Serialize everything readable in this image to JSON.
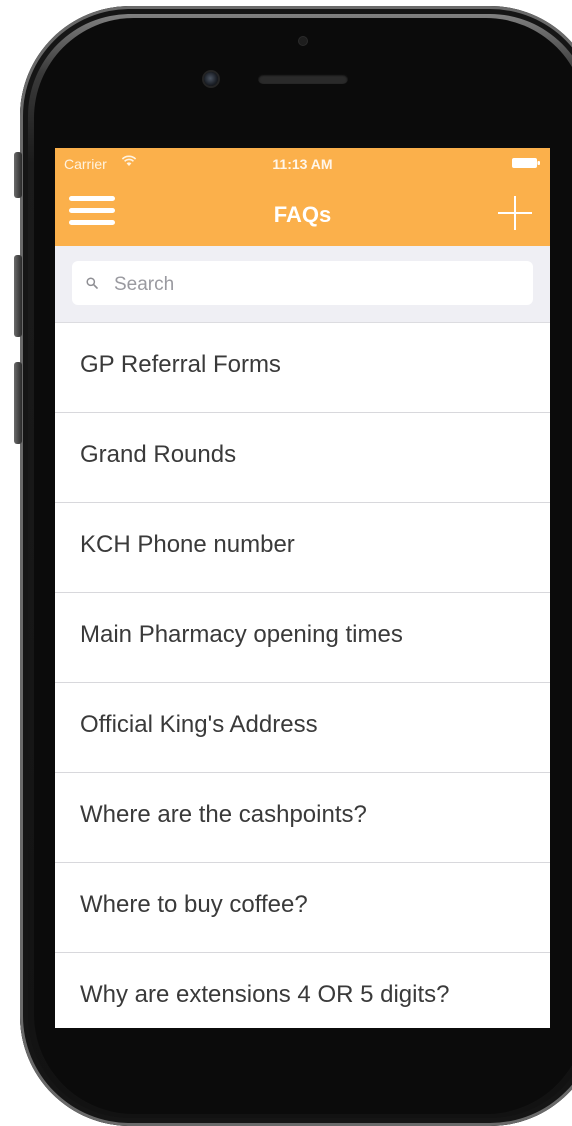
{
  "status_bar": {
    "carrier": "Carrier",
    "time": "11:13 AM"
  },
  "nav_bar": {
    "title": "FAQs",
    "menu_icon": "hamburger-menu-icon",
    "add_icon": "plus-icon"
  },
  "search": {
    "placeholder": "Search",
    "icon": "search-icon"
  },
  "faq_items": [
    {
      "label": "GP Referral Forms"
    },
    {
      "label": "Grand Rounds"
    },
    {
      "label": "KCH Phone number"
    },
    {
      "label": "Main Pharmacy opening times"
    },
    {
      "label": "Official King's Address"
    },
    {
      "label": "Where are the cashpoints?"
    },
    {
      "label": "Where to buy coffee?"
    },
    {
      "label": "Why are extensions 4 OR 5 digits?"
    }
  ],
  "colors": {
    "accent": "#fbb04b",
    "search_background": "#efeff4",
    "text": "#3a3a3a"
  }
}
